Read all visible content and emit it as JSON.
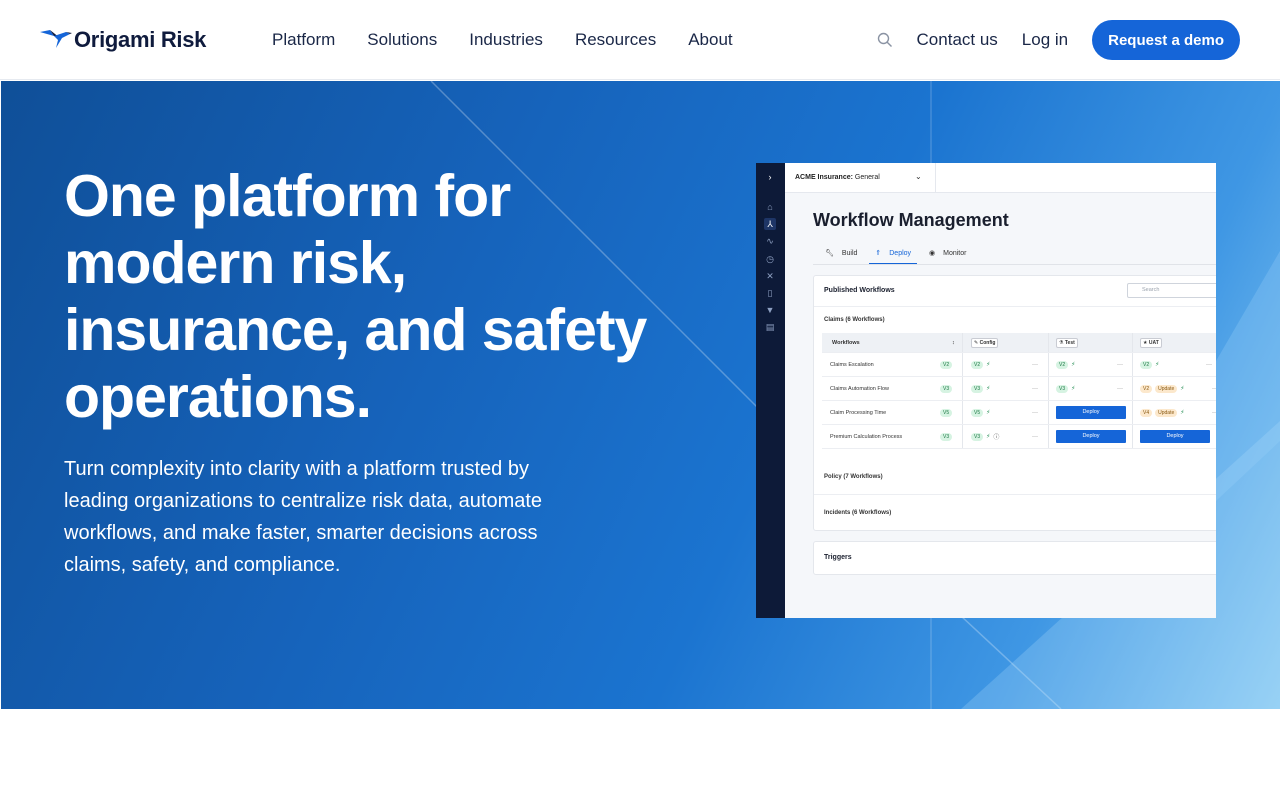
{
  "header": {
    "logo": "Origami Risk",
    "nav": [
      "Platform",
      "Solutions",
      "Industries",
      "Resources",
      "About"
    ],
    "contact": "Contact us",
    "login": "Log in",
    "demo_button": "Request a demo",
    "icons": {
      "search": "search-icon",
      "logo": "bird-logo-icon"
    }
  },
  "hero": {
    "headline": "One platform for modern risk, insurance, and safety operations.",
    "subtext": "Turn complexity into clarity with a platform trusted by leading organizations to centralize risk data, automate workflows, and make faster, smarter decisions across claims, safety, and compliance."
  },
  "mockup": {
    "account_label": "ACME Insurance:",
    "account_value": "General",
    "title": "Workflow Management",
    "tabs": [
      "Build",
      "Deploy",
      "Monitor"
    ],
    "active_tab": "Deploy",
    "published_title": "Published Workflows",
    "search_placeholder": "Search",
    "claims_section": "Claims (6 Workflows)",
    "columns": [
      "Workflows",
      "Config",
      "Test",
      "UAT"
    ],
    "rows": [
      {
        "name": "Claims Escalation",
        "version": "V2",
        "config": "V2",
        "test": "V2",
        "uat": "V2",
        "uat_update": ""
      },
      {
        "name": "Claims Automation Flow",
        "version": "V3",
        "config": "V3",
        "test": "V3",
        "uat": "V2",
        "uat_update": "Update"
      },
      {
        "name": "Claim Processing Time",
        "version": "V5",
        "config": "V5",
        "test": "Deploy",
        "uat": "V4",
        "uat_update": "Update"
      },
      {
        "name": "Premium Calculation Process",
        "version": "V3",
        "config": "V3",
        "test": "Deploy",
        "uat": "Deploy",
        "uat_update": ""
      }
    ],
    "policy_section": "Policy (7 Workflows)",
    "incidents_section": "Incidents (6 Workflows)",
    "triggers": "Triggers",
    "colors": {
      "primary": "#1565d8",
      "sidebar": "#0d1a38",
      "pill_green": "#d6f3e2",
      "pill_amber": "#fce8cc"
    }
  },
  "colors": {
    "brand": "#1565d8",
    "hero_dark": "#0f4f98",
    "hero_light": "#8fcdf3"
  }
}
